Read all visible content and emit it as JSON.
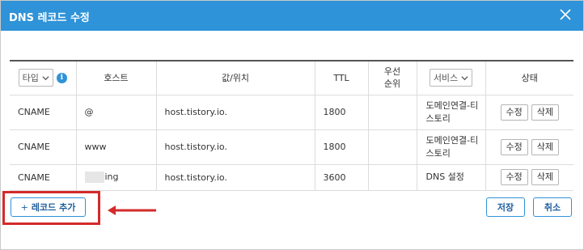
{
  "dialog": {
    "title": "DNS 레코드 수정",
    "close_icon": "close-icon",
    "accent_color": "#2e93d8"
  },
  "table": {
    "headers": {
      "type_select": "타입",
      "host": "호스트",
      "value": "값/위치",
      "ttl": "TTL",
      "priority_line1": "우선",
      "priority_line2": "순위",
      "service_select": "서비스",
      "status": "상태"
    },
    "rows": [
      {
        "type": "CNAME",
        "host": "@",
        "value": "host.tistory.io.",
        "ttl": "1800",
        "priority": "",
        "service_line1": "도메인연결-티",
        "service_line2": "스토리",
        "edit": "수정",
        "delete": "삭제"
      },
      {
        "type": "CNAME",
        "host": "www",
        "value": "host.tistory.io.",
        "ttl": "1800",
        "priority": "",
        "service_line1": "도메인연결-티",
        "service_line2": "스토리",
        "edit": "수정",
        "delete": "삭제"
      },
      {
        "type": "CNAME",
        "host": "ing",
        "value": "host.tistory.io.",
        "ttl": "3600",
        "priority": "",
        "service_line1": "DNS 설정",
        "service_line2": "",
        "edit": "수정",
        "delete": "삭제"
      }
    ]
  },
  "footer": {
    "add_record": "레코드 추가",
    "add_icon": "+",
    "save": "저장",
    "cancel": "취소"
  },
  "annotation": {
    "highlight_color": "#d32a2a"
  }
}
